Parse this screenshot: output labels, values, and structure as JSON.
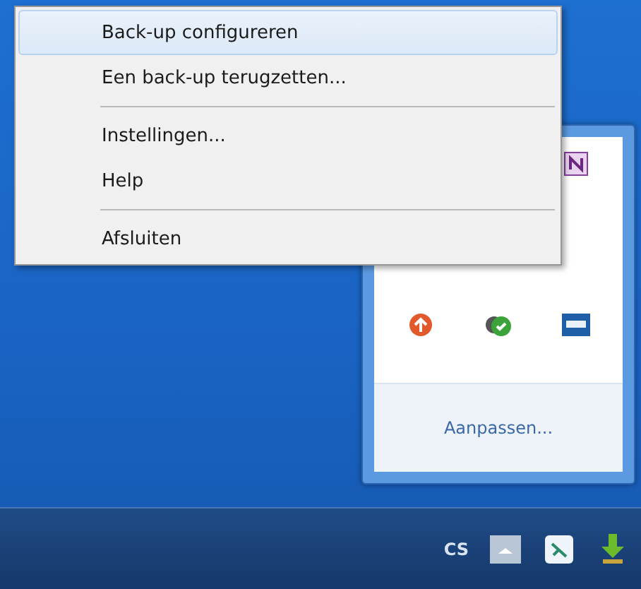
{
  "context_menu": {
    "items": [
      {
        "kind": "item",
        "label": "Back-up configureren",
        "selected": true
      },
      {
        "kind": "item",
        "label": "Een back-up terugzetten...",
        "selected": false
      },
      {
        "kind": "separator"
      },
      {
        "kind": "item",
        "label": "Instellingen...",
        "selected": false
      },
      {
        "kind": "item",
        "label": "Help",
        "selected": false
      },
      {
        "kind": "separator"
      },
      {
        "kind": "item",
        "label": "Afsluiten",
        "selected": false
      }
    ]
  },
  "tray_popup": {
    "link": "Aanpassen..."
  },
  "taskbar": {
    "language": "CS"
  }
}
